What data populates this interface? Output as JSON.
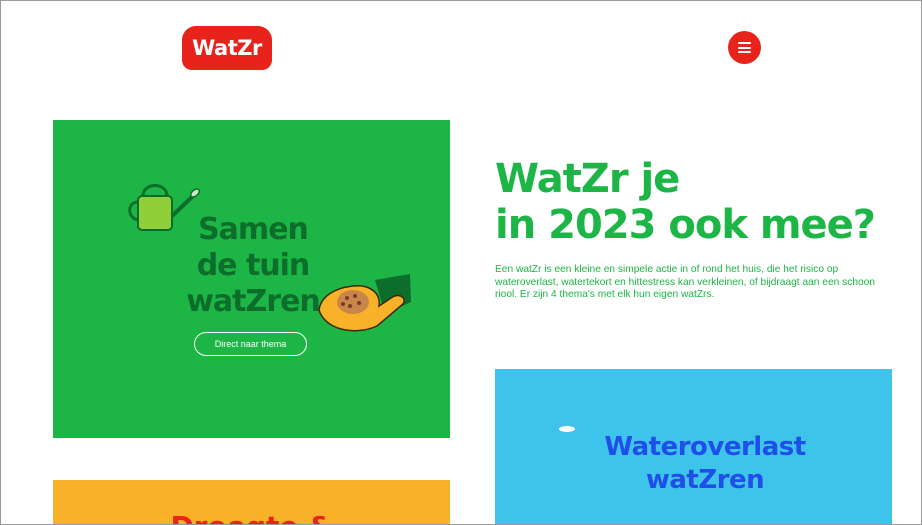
{
  "header": {
    "logo_text": "WatZr",
    "menu_icon": "hamburger-icon"
  },
  "colors": {
    "brand_red": "#e8231c",
    "green": "#1db646",
    "dark_green": "#0d6e2b",
    "blue": "#3ec3ea",
    "blue_text": "#1f4fe8",
    "yellow": "#f9b12a"
  },
  "cards": {
    "tuin": {
      "headline_lines": [
        "Samen",
        "de tuin",
        "watZren"
      ],
      "cta_label": "Direct naar thema",
      "icons": [
        "watering-can-icon",
        "hand-with-seeds-icon"
      ]
    },
    "wateroverlast": {
      "headline_lines": [
        "Wateroverlast",
        "watZren"
      ]
    },
    "droogte": {
      "headline_visible": "Droogte &"
    }
  },
  "hero": {
    "title_lines": [
      "WatZr je",
      "in 2023 ook mee?"
    ],
    "body": "Een watZr is een kleine en simpele actie in of rond het huis, die het risico op wateroverlast, watertekort en hittestress kan verkleinen, of bijdraagt aan een schoon riool. Er zijn 4 thema's met elk hun eigen watZrs."
  }
}
